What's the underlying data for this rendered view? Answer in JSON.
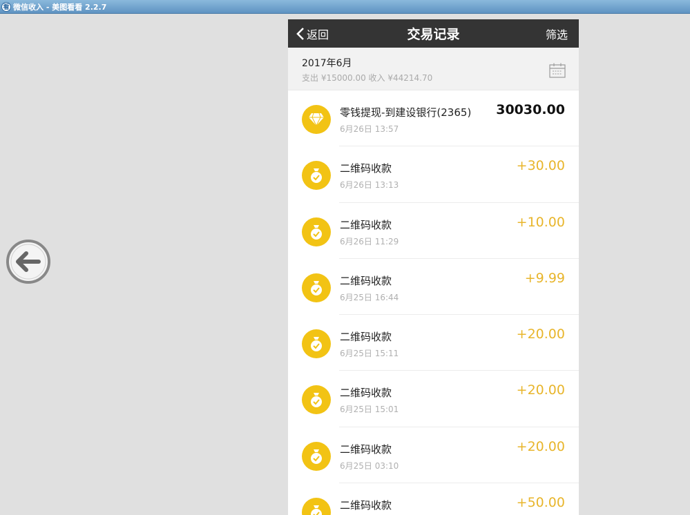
{
  "window": {
    "title": "微信收入 - 美图看看 2.2.7"
  },
  "nav": {
    "back_label": "返回",
    "title": "交易记录",
    "filter_label": "筛选"
  },
  "month": {
    "label": "2017年6月",
    "summary": "支出 ¥15000.00 收入 ¥44214.70"
  },
  "transactions": [
    {
      "name": "零钱提现-到建设银行(2365)",
      "time": "6月26日 13:57",
      "amount": "30030.00",
      "icon": "diamond-icon"
    },
    {
      "name": "二维码收款",
      "time": "6月26日 13:13",
      "amount": "+30.00",
      "icon": "money-bag-icon"
    },
    {
      "name": "二维码收款",
      "time": "6月26日 11:29",
      "amount": "+10.00",
      "icon": "money-bag-icon"
    },
    {
      "name": "二维码收款",
      "time": "6月25日 16:44",
      "amount": "+9.99",
      "icon": "money-bag-icon"
    },
    {
      "name": "二维码收款",
      "time": "6月25日 15:11",
      "amount": "+20.00",
      "icon": "money-bag-icon"
    },
    {
      "name": "二维码收款",
      "time": "6月25日 15:01",
      "amount": "+20.00",
      "icon": "money-bag-icon"
    },
    {
      "name": "二维码收款",
      "time": "6月25日 03:10",
      "amount": "+20.00",
      "icon": "money-bag-icon"
    },
    {
      "name": "二维码收款",
      "time": "",
      "amount": "+50.00",
      "icon": "money-bag-icon"
    }
  ],
  "colors": {
    "accent": "#f2c314",
    "income": "#e8b52b",
    "navbar": "#343434"
  }
}
